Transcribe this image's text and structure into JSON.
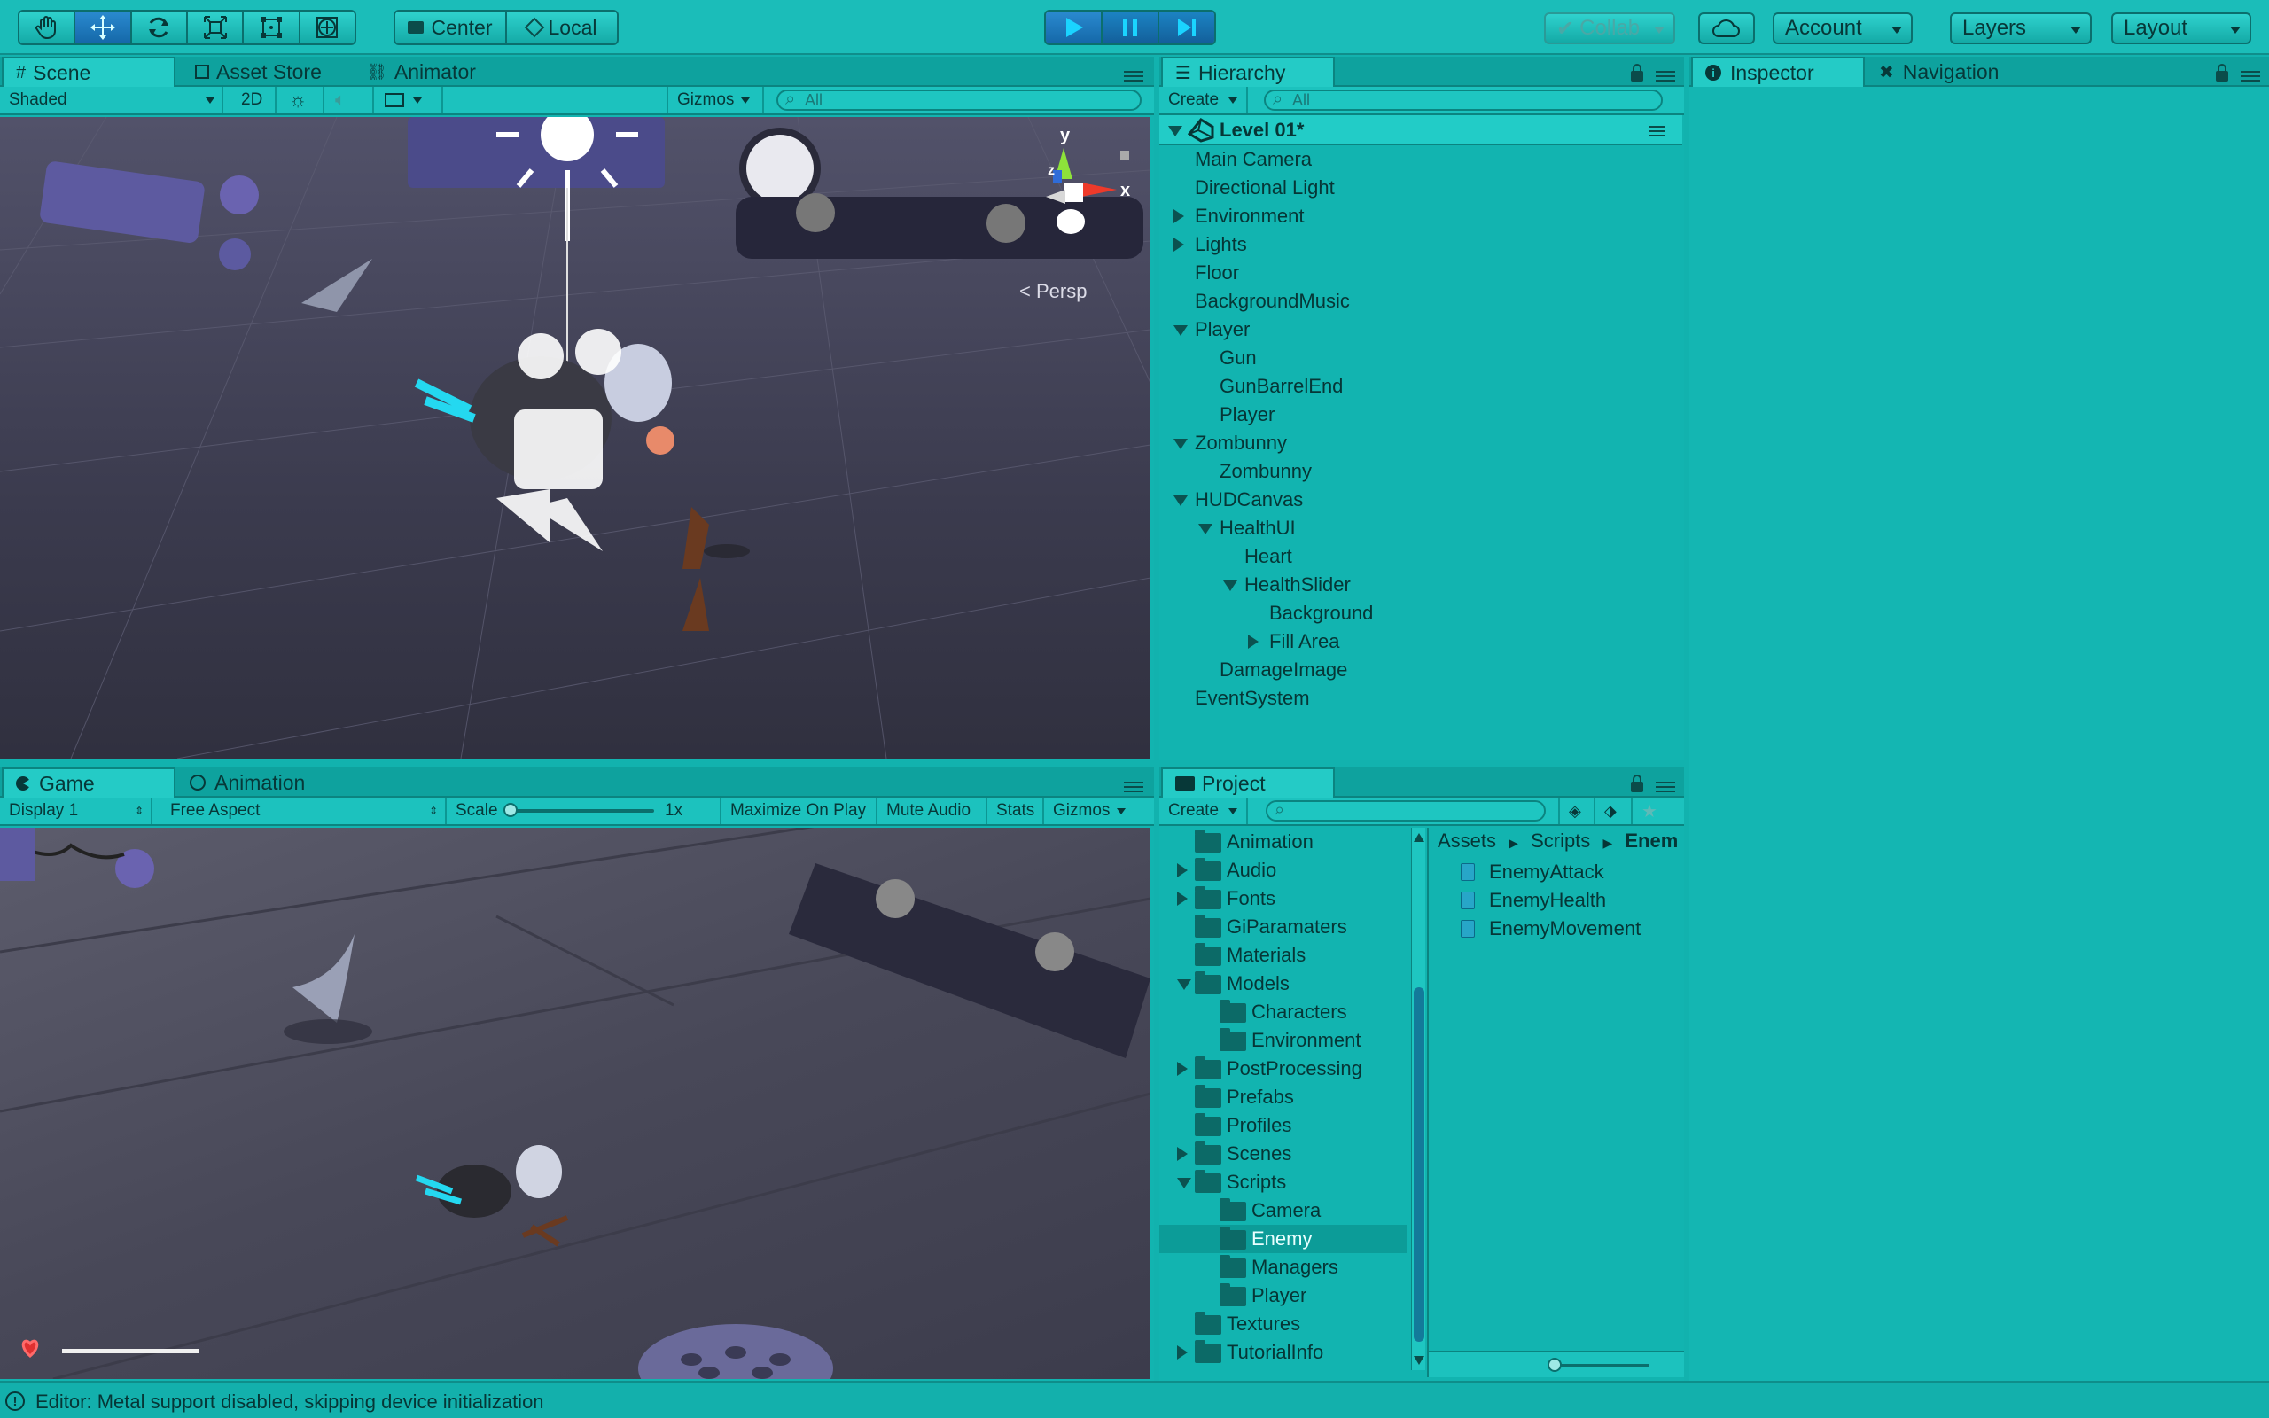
{
  "toolbar": {
    "tools": [
      "hand-tool",
      "move-tool",
      "rotate-tool",
      "scale-tool",
      "rect-tool",
      "transform-tool"
    ],
    "pivot_label": "Center",
    "space_label": "Local",
    "collab_label": "Collab",
    "account_label": "Account",
    "layers_label": "Layers",
    "layout_label": "Layout"
  },
  "scene_panel": {
    "tabs": [
      "Scene",
      "Asset Store",
      "Animator"
    ],
    "shading": "Shaded",
    "mode_2d": "2D",
    "gizmos": "Gizmos",
    "search_placeholder": "All",
    "persp_label": "Persp",
    "axis_y": "y",
    "axis_x": "x",
    "axis_z": "z"
  },
  "game_panel": {
    "tabs": [
      "Game",
      "Animation"
    ],
    "display": "Display 1",
    "aspect": "Free Aspect",
    "scale_label": "Scale",
    "scale_value": "1x",
    "maximize": "Maximize On Play",
    "mute": "Mute Audio",
    "stats": "Stats",
    "gizmos": "Gizmos"
  },
  "hierarchy": {
    "tab": "Hierarchy",
    "create": "Create",
    "search_placeholder": "All",
    "scene_name": "Level 01*",
    "items": [
      {
        "label": "Main Camera",
        "depth": 0,
        "arrow": "none"
      },
      {
        "label": "Directional Light",
        "depth": 0,
        "arrow": "none"
      },
      {
        "label": "Environment",
        "depth": 0,
        "arrow": "right"
      },
      {
        "label": "Lights",
        "depth": 0,
        "arrow": "right"
      },
      {
        "label": "Floor",
        "depth": 0,
        "arrow": "none"
      },
      {
        "label": "BackgroundMusic",
        "depth": 0,
        "arrow": "none"
      },
      {
        "label": "Player",
        "depth": 0,
        "arrow": "down"
      },
      {
        "label": "Gun",
        "depth": 1,
        "arrow": "none"
      },
      {
        "label": "GunBarrelEnd",
        "depth": 1,
        "arrow": "none"
      },
      {
        "label": "Player",
        "depth": 1,
        "arrow": "none"
      },
      {
        "label": "Zombunny",
        "depth": 0,
        "arrow": "down"
      },
      {
        "label": "Zombunny",
        "depth": 1,
        "arrow": "none"
      },
      {
        "label": "HUDCanvas",
        "depth": 0,
        "arrow": "down"
      },
      {
        "label": "HealthUI",
        "depth": 1,
        "arrow": "down"
      },
      {
        "label": "Heart",
        "depth": 2,
        "arrow": "none"
      },
      {
        "label": "HealthSlider",
        "depth": 2,
        "arrow": "down"
      },
      {
        "label": "Background",
        "depth": 3,
        "arrow": "none"
      },
      {
        "label": "Fill Area",
        "depth": 3,
        "arrow": "right"
      },
      {
        "label": "DamageImage",
        "depth": 1,
        "arrow": "none"
      },
      {
        "label": "EventSystem",
        "depth": 0,
        "arrow": "none"
      }
    ]
  },
  "inspector": {
    "tab": "Inspector",
    "nav_tab": "Navigation"
  },
  "project": {
    "tab": "Project",
    "create": "Create",
    "folders": [
      {
        "label": "Animation",
        "depth": 0,
        "arrow": "none"
      },
      {
        "label": "Audio",
        "depth": 0,
        "arrow": "right"
      },
      {
        "label": "Fonts",
        "depth": 0,
        "arrow": "right"
      },
      {
        "label": "GiParamaters",
        "depth": 0,
        "arrow": "none"
      },
      {
        "label": "Materials",
        "depth": 0,
        "arrow": "none"
      },
      {
        "label": "Models",
        "depth": 0,
        "arrow": "down"
      },
      {
        "label": "Characters",
        "depth": 1,
        "arrow": "none"
      },
      {
        "label": "Environment",
        "depth": 1,
        "arrow": "none"
      },
      {
        "label": "PostProcessing",
        "depth": 0,
        "arrow": "right"
      },
      {
        "label": "Prefabs",
        "depth": 0,
        "arrow": "none"
      },
      {
        "label": "Profiles",
        "depth": 0,
        "arrow": "none"
      },
      {
        "label": "Scenes",
        "depth": 0,
        "arrow": "right"
      },
      {
        "label": "Scripts",
        "depth": 0,
        "arrow": "down"
      },
      {
        "label": "Camera",
        "depth": 1,
        "arrow": "none"
      },
      {
        "label": "Enemy",
        "depth": 1,
        "arrow": "none",
        "selected": true
      },
      {
        "label": "Managers",
        "depth": 1,
        "arrow": "none"
      },
      {
        "label": "Player",
        "depth": 1,
        "arrow": "none"
      },
      {
        "label": "Textures",
        "depth": 0,
        "arrow": "none"
      },
      {
        "label": "TutorialInfo",
        "depth": 0,
        "arrow": "right"
      }
    ],
    "breadcrumb": [
      "Assets",
      "Scripts",
      "Enem"
    ],
    "files": [
      "EnemyAttack",
      "EnemyHealth",
      "EnemyMovement"
    ]
  },
  "status": {
    "message": "Editor: Metal support disabled, skipping device initialization"
  }
}
